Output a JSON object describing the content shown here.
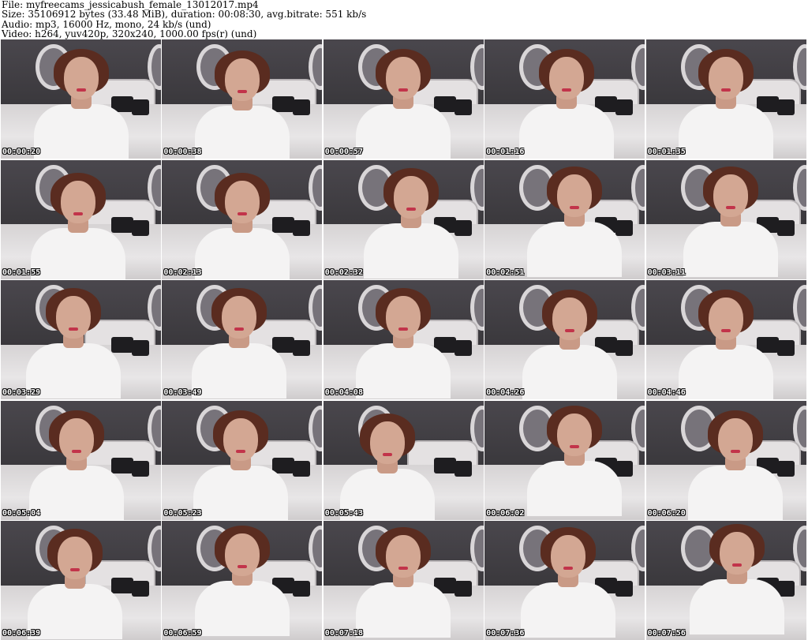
{
  "header": {
    "file_line": "File: myfreecams_jessicabush_female_13012017.mp4",
    "size_line": "Size: 35106912 bytes (33.48 MiB), duration: 00:08:30, avg.bitrate: 551 kb/s",
    "audio_line": "Audio: mp3, 16000 Hz, mono, 24 kb/s (und)",
    "video_line": "Video: h264, yuv420p, 320x240, 1000.00 fps(r) (und)"
  },
  "colors": {
    "background": "#ffffff",
    "wall": "#3c3a3e",
    "top": "#f4f3f3",
    "hair": "#5a2c20",
    "skin": "#d3a793",
    "lips": "#c2344a",
    "timestamp_text": "#ffffff",
    "timestamp_outline": "#000000"
  },
  "thumbnails": [
    {
      "timestamp": "00:00:20"
    },
    {
      "timestamp": "00:00:38"
    },
    {
      "timestamp": "00:00:57"
    },
    {
      "timestamp": "00:01:16"
    },
    {
      "timestamp": "00:01:35"
    },
    {
      "timestamp": "00:01:55"
    },
    {
      "timestamp": "00:02:13"
    },
    {
      "timestamp": "00:02:32"
    },
    {
      "timestamp": "00:02:51"
    },
    {
      "timestamp": "00:03:11"
    },
    {
      "timestamp": "00:03:29"
    },
    {
      "timestamp": "00:03:49"
    },
    {
      "timestamp": "00:04:08"
    },
    {
      "timestamp": "00:04:26"
    },
    {
      "timestamp": "00:04:46"
    },
    {
      "timestamp": "00:05:04"
    },
    {
      "timestamp": "00:05:23"
    },
    {
      "timestamp": "00:05:43"
    },
    {
      "timestamp": "00:06:02"
    },
    {
      "timestamp": "00:06:20"
    },
    {
      "timestamp": "00:06:39"
    },
    {
      "timestamp": "00:06:59"
    },
    {
      "timestamp": "00:07:18"
    },
    {
      "timestamp": "00:07:36"
    },
    {
      "timestamp": "00:07:56"
    }
  ]
}
